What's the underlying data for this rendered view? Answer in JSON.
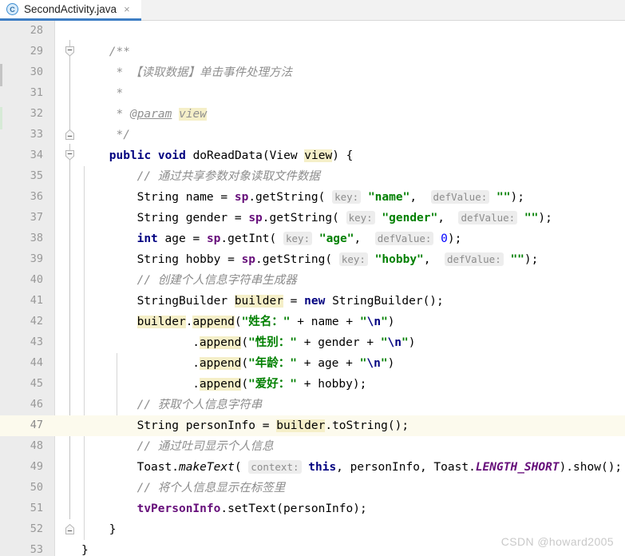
{
  "tab": {
    "icon": "java-class-icon",
    "filename": "SecondActivity.java",
    "close": "×"
  },
  "editor": {
    "first_line_number": 28,
    "last_line_number": 53,
    "caret_line_number": 47,
    "colors": {
      "keyword": "#000080",
      "string": "#008000",
      "field": "#660E7A",
      "comment": "#8C8C8C",
      "number": "#0000FF",
      "caret_row_bg": "#FCFAED",
      "identifier_highlight": "#F5EFC8",
      "gutter_bg": "#ECECEC",
      "tab_underline": "#3E7EC4"
    },
    "lines": [
      {
        "n": 28,
        "text": ""
      },
      {
        "n": 29,
        "text": "    /**"
      },
      {
        "n": 30,
        "text": "     * 【读取数据】单击事件处理方法"
      },
      {
        "n": 31,
        "text": "     *"
      },
      {
        "n": 32,
        "text": "     * @param view"
      },
      {
        "n": 33,
        "text": "     */"
      },
      {
        "n": 34,
        "text": "    public void doReadData(View view) {"
      },
      {
        "n": 35,
        "text": "        // 通过共享参数对象读取文件数据"
      },
      {
        "n": 36,
        "text": "        String name = sp.getString( key: \"name\",  defValue: \"\");"
      },
      {
        "n": 37,
        "text": "        String gender = sp.getString( key: \"gender\",  defValue: \"\");"
      },
      {
        "n": 38,
        "text": "        int age = sp.getInt( key: \"age\",  defValue: 0);"
      },
      {
        "n": 39,
        "text": "        String hobby = sp.getString( key: \"hobby\",  defValue: \"\");"
      },
      {
        "n": 40,
        "text": "        // 创建个人信息字符串生成器"
      },
      {
        "n": 41,
        "text": "        StringBuilder builder = new StringBuilder();"
      },
      {
        "n": 42,
        "text": "        builder.append(\"姓名：\" + name + \"\\n\")"
      },
      {
        "n": 43,
        "text": "                .append(\"性别：\" + gender + \"\\n\")"
      },
      {
        "n": 44,
        "text": "                .append(\"年龄：\" + age + \"\\n\")"
      },
      {
        "n": 45,
        "text": "                .append(\"爱好：\" + hobby);"
      },
      {
        "n": 46,
        "text": "        // 获取个人信息字符串"
      },
      {
        "n": 47,
        "text": "        String personInfo = builder.toString();"
      },
      {
        "n": 48,
        "text": "        // 通过吐司显示个人信息"
      },
      {
        "n": 49,
        "text": "        Toast.makeText( context: this, personInfo, Toast.LENGTH_SHORT).show();"
      },
      {
        "n": 50,
        "text": "        // 将个人信息显示在标签里"
      },
      {
        "n": 51,
        "text": "        tvPersonInfo.setText(personInfo);"
      },
      {
        "n": 52,
        "text": "    }"
      },
      {
        "n": 53,
        "text": "}"
      }
    ],
    "fold_markers": [
      {
        "line": 29,
        "kind": "region-start"
      },
      {
        "line": 33,
        "kind": "region-end"
      },
      {
        "line": 34,
        "kind": "region-start"
      },
      {
        "line": 52,
        "kind": "region-end"
      }
    ],
    "parameter_hints": [
      "key:",
      "defValue:",
      "context:"
    ],
    "highlighted_identifiers": [
      "view",
      "builder",
      "append"
    ]
  },
  "watermark": {
    "text": "CSDN @howard2005"
  }
}
